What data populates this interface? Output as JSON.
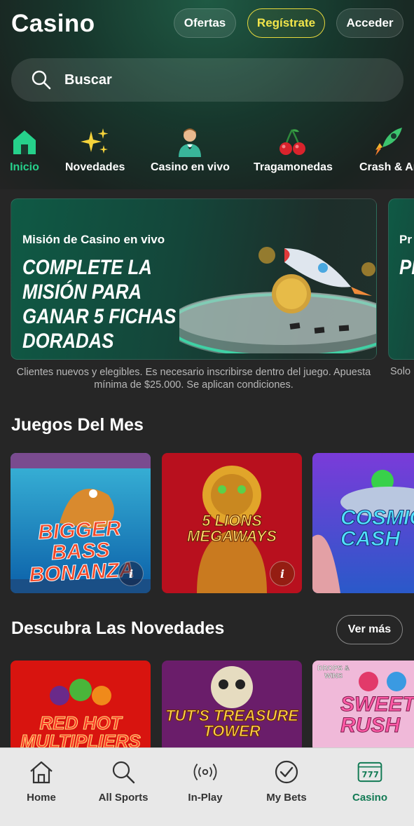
{
  "header": {
    "logo": "Casino",
    "ofertas": "Ofertas",
    "registrate": "Regístrate",
    "acceder": "Acceder"
  },
  "search": {
    "placeholder": "Buscar"
  },
  "categories": [
    {
      "label": "Inicio",
      "icon": "home-icon",
      "active": true
    },
    {
      "label": "Novedades",
      "icon": "sparkles-icon"
    },
    {
      "label": "Casino en vivo",
      "icon": "dealer-icon"
    },
    {
      "label": "Tragamonedas",
      "icon": "cherries-icon"
    },
    {
      "label": "Crash & Ar",
      "icon": "rocket-icon"
    }
  ],
  "promo": {
    "title": "Misión de Casino en vivo",
    "headline": "COMPLETE LA MISIÓN PARA GANAR 5 FICHAS DORADAS",
    "disclaimer": "Clientes nuevos y elegibles. Es necesario inscribirse dentro del juego. Apuesta mínima de $25.000. Se aplican condiciones.",
    "next_title": "Pr",
    "next_headline": "PI C RI",
    "next_disclaimer": "Solo"
  },
  "juegos_del_mes": {
    "title": "Juegos Del Mes",
    "games": [
      {
        "name": "BIGGER BASS BONANZA",
        "info": "i"
      },
      {
        "name": "5 LIONS MEGAWAYS",
        "info": "i"
      },
      {
        "name": "COSMIC CASH"
      }
    ]
  },
  "novedades": {
    "title": "Descubra Las Novedades",
    "ver_mas": "Ver más",
    "games": [
      {
        "name": "RED HOT MULTIPLIERS"
      },
      {
        "name": "TUT'S TREASURE TOWER"
      },
      {
        "name": "SWEET RUSH",
        "badge": "DROPS & WINS"
      }
    ]
  },
  "bottom_nav": [
    {
      "label": "Home",
      "icon": "home-outline-icon"
    },
    {
      "label": "All Sports",
      "icon": "search-icon"
    },
    {
      "label": "In-Play",
      "icon": "live-signal-icon"
    },
    {
      "label": "My Bets",
      "icon": "check-circle-icon"
    },
    {
      "label": "Casino",
      "icon": "slot-machine-icon",
      "active": true
    }
  ],
  "colors": {
    "accent_green": "#26d18b",
    "register_yellow": "#f2e54a",
    "casino_nav_green": "#127a54"
  }
}
